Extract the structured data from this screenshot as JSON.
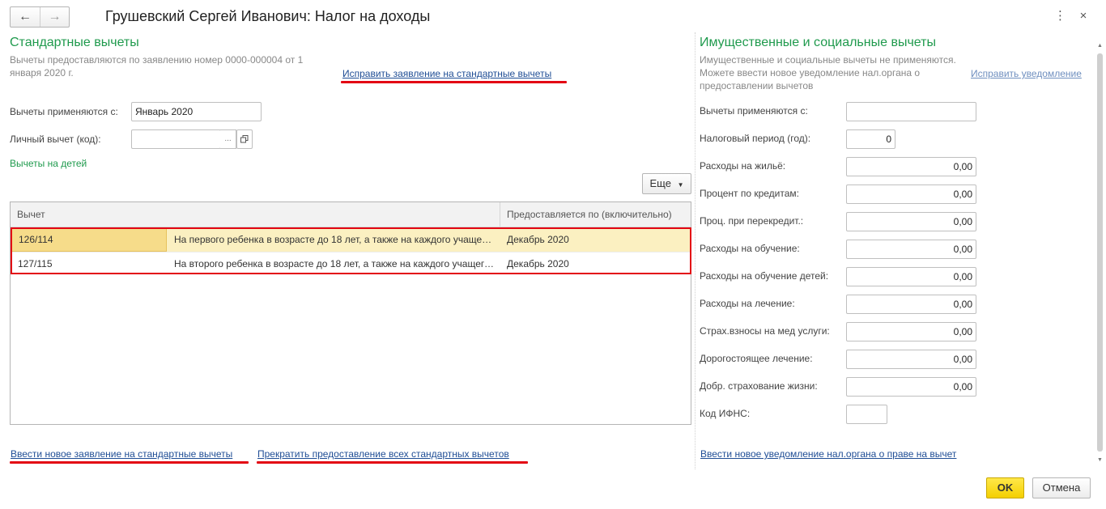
{
  "window": {
    "title": "Грушевский Сергей Иванович: Налог на доходы",
    "back_icon": "arrow-left-icon",
    "forward_icon": "arrow-right-icon",
    "menu_icon": "⋮",
    "close_icon": "×"
  },
  "standard": {
    "heading": "Стандартные вычеты",
    "note": "Вычеты предоставляются по заявлению номер 0000-000004 от 1 января 2020 г.",
    "fix_link": "Исправить заявление на стандартные вычеты",
    "applied_from_label": "Вычеты применяются с:",
    "applied_from_value": "Январь 2020",
    "personal_label": "Личный вычет (код):",
    "personal_value": "",
    "personal_select": "...",
    "children_link": "Вычеты на детей",
    "more_button": "Еще",
    "table": {
      "col_deduction": "Вычет",
      "col_until": "Предоставляется по (включительно)",
      "rows": [
        {
          "code": "126/114",
          "desc": "На первого ребенка в возрасте до 18 лет, а также на каждого учащегося очной формы обучения",
          "until": "Декабрь 2020"
        },
        {
          "code": "127/115",
          "desc": "На второго ребенка в возрасте до 18 лет, а также на каждого учащегося очной формы обучения",
          "until": "Декабрь 2020"
        }
      ]
    },
    "new_statement_link": "Ввести новое заявление на стандартные вычеты",
    "stop_link": "Прекратить предоставление всех стандартных вычетов"
  },
  "property": {
    "heading": "Имущественные и социальные вычеты",
    "note": "Имущественные и социальные вычеты не применяются. Можете ввести новое уведомление нал.органа о предоставлении вычетов",
    "fix_link": "Исправить уведомление",
    "fields": [
      {
        "label": "Вычеты применяются с:",
        "value": ""
      },
      {
        "label": "Налоговый период (год):",
        "value": "0"
      },
      {
        "label": "Расходы на жильё:",
        "value": "0,00"
      },
      {
        "label": "Процент по кредитам:",
        "value": "0,00"
      },
      {
        "label": "Проц. при перекредит.:",
        "value": "0,00"
      },
      {
        "label": "Расходы на обучение:",
        "value": "0,00"
      },
      {
        "label": "Расходы на обучение детей:",
        "value": "0,00"
      },
      {
        "label": "Расходы на лечение:",
        "value": "0,00"
      },
      {
        "label": "Страх.взносы на мед услуги:",
        "value": "0,00"
      },
      {
        "label": "Дорогостоящее лечение:",
        "value": "0,00"
      },
      {
        "label": "Добр. страхование жизни:",
        "value": "0,00"
      },
      {
        "label": "Код ИФНС:",
        "value": ""
      }
    ],
    "new_notice_link": "Ввести новое уведомление нал.органа о праве на вычет"
  },
  "footer": {
    "ok": "OK",
    "cancel": "Отмена"
  },
  "colors": {
    "heading_green": "#1f9a4d",
    "link_blue": "#1f4d95",
    "highlight_red": "#e30613",
    "row_selected": "#fbf0c1",
    "ok_yellow": "#f4cf00"
  }
}
